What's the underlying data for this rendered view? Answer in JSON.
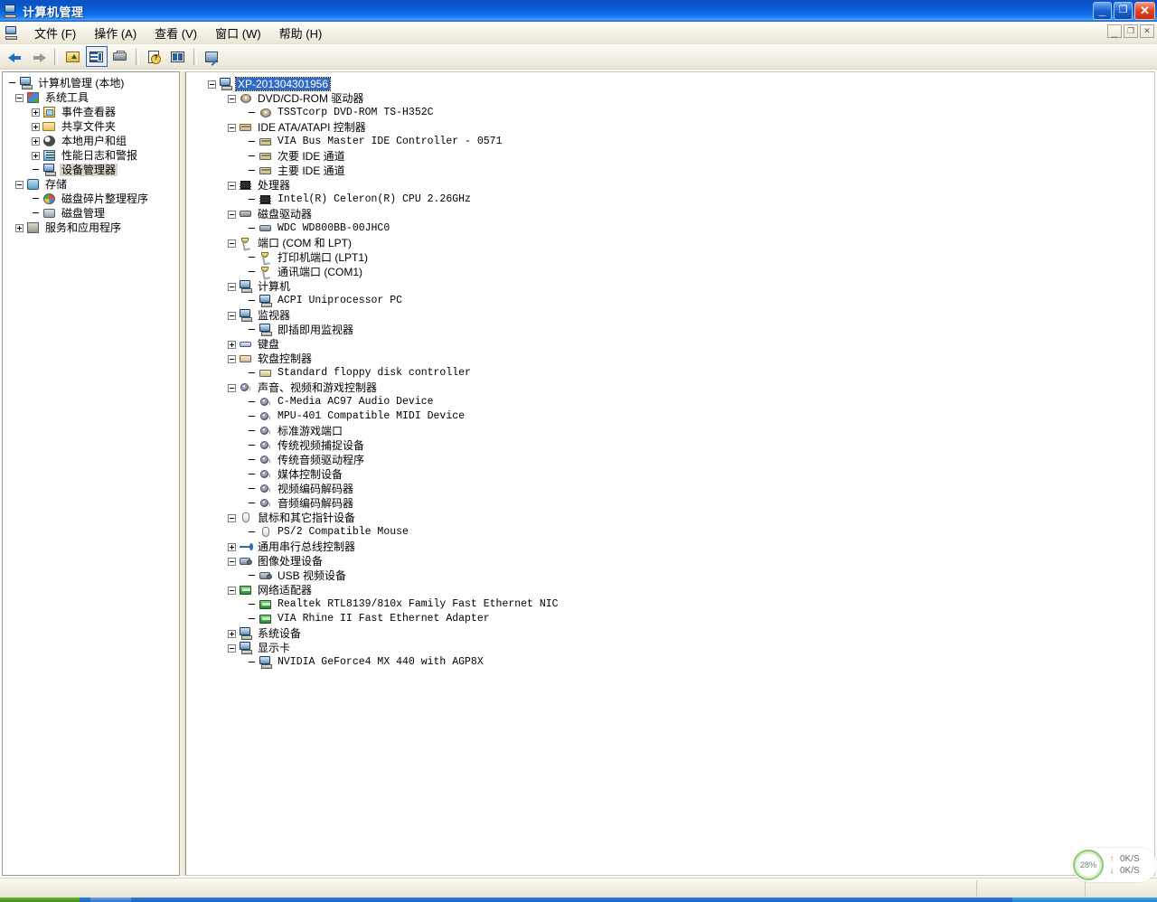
{
  "window": {
    "title": "计算机管理",
    "title_icon": "computer-management-icon",
    "buttons": {
      "minimize": "_",
      "maximize": "❐",
      "close": "✕"
    }
  },
  "menubar": {
    "icon": "console-icon",
    "items": [
      {
        "label": "文件 (F)",
        "name": "menu-file"
      },
      {
        "label": "操作 (A)",
        "name": "menu-action"
      },
      {
        "label": "查看 (V)",
        "name": "menu-view"
      },
      {
        "label": "窗口 (W)",
        "name": "menu-window"
      },
      {
        "label": "帮助 (H)",
        "name": "menu-help"
      }
    ]
  },
  "toolbar": {
    "buttons": [
      {
        "name": "back-icon",
        "tip": "后退"
      },
      {
        "name": "forward-icon",
        "tip": "前进"
      },
      {
        "name": "up-one-level-icon",
        "tip": "向上一级"
      },
      {
        "name": "show-hide-tree-icon",
        "tip": "显示/隐藏控制台树",
        "pressed": true
      },
      {
        "name": "print-icon",
        "tip": "打印"
      },
      {
        "name": "properties-icon",
        "tip": "属性"
      },
      {
        "name": "two-pane-view-icon",
        "tip": "查看"
      },
      {
        "name": "scan-hardware-changes-icon",
        "tip": "扫描检测硬件改动"
      }
    ]
  },
  "child_window_buttons": {
    "minimize": "_",
    "restore": "❐",
    "close": "✕"
  },
  "console_tree": {
    "root": {
      "label": "计算机管理 (本地)",
      "icon": "computer-icon",
      "level": 0,
      "expander": "none"
    },
    "items": [
      {
        "label": "系统工具",
        "icon": "system-tools-icon",
        "level": 1,
        "expander": "minus",
        "name": "tree-item-system-tools"
      },
      {
        "label": "事件查看器",
        "icon": "event-viewer-icon",
        "level": 2,
        "expander": "plus",
        "name": "tree-item-event-viewer"
      },
      {
        "label": "共享文件夹",
        "icon": "shared-folders-icon",
        "level": 2,
        "expander": "plus",
        "name": "tree-item-shared-folders"
      },
      {
        "label": "本地用户和组",
        "icon": "local-users-groups-icon",
        "level": 2,
        "expander": "plus",
        "name": "tree-item-local-users-and-groups"
      },
      {
        "label": "性能日志和警报",
        "icon": "performance-logs-icon",
        "level": 2,
        "expander": "plus",
        "name": "tree-item-performance-logs-and-alerts"
      },
      {
        "label": "设备管理器",
        "icon": "device-manager-icon",
        "level": 2,
        "expander": "none",
        "selected": true,
        "name": "tree-item-device-manager"
      },
      {
        "label": "存储",
        "icon": "storage-icon",
        "level": 1,
        "expander": "minus",
        "name": "tree-item-storage"
      },
      {
        "label": "磁盘碎片整理程序",
        "icon": "disk-defragmenter-icon",
        "level": 2,
        "expander": "none",
        "name": "tree-item-disk-defragmenter"
      },
      {
        "label": "磁盘管理",
        "icon": "disk-management-icon",
        "level": 2,
        "expander": "none",
        "name": "tree-item-disk-management"
      },
      {
        "label": "服务和应用程序",
        "icon": "services-applications-icon",
        "level": 1,
        "expander": "plus",
        "name": "tree-item-services-and-applications"
      }
    ]
  },
  "device_tree": {
    "root": {
      "label": "XP-201304301956",
      "icon": "computer-icon",
      "expander": "minus",
      "selected": true,
      "name": "device-tree-root"
    },
    "categories": [
      {
        "label": "DVD/CD-ROM 驱动器",
        "icon": "cdrom-icon",
        "expander": "minus",
        "name": "device-category-dvd-cdrom",
        "children": [
          {
            "label": "TSSTcorp DVD-ROM TS-H352C",
            "icon": "cdrom-icon",
            "mono": true
          }
        ]
      },
      {
        "label": "IDE ATA/ATAPI 控制器",
        "icon": "ide-controller-icon",
        "expander": "minus",
        "name": "device-category-ide-ata-atapi",
        "children": [
          {
            "label": "VIA Bus Master IDE Controller - 0571",
            "icon": "ide-controller-icon",
            "mono": true
          },
          {
            "label": "次要 IDE 通道",
            "icon": "ide-controller-icon"
          },
          {
            "label": "主要 IDE 通道",
            "icon": "ide-controller-icon"
          }
        ]
      },
      {
        "label": "处理器",
        "icon": "cpu-icon",
        "expander": "minus",
        "name": "device-category-processors",
        "children": [
          {
            "label": "Intel(R) Celeron(R) CPU 2.26GHz",
            "icon": "cpu-icon",
            "mono": true
          }
        ]
      },
      {
        "label": "磁盘驱动器",
        "icon": "disk-drive-icon",
        "expander": "minus",
        "name": "device-category-disk-drives",
        "children": [
          {
            "label": "WDC WD800BB-00JHC0",
            "icon": "disk-drive-icon",
            "mono": true
          }
        ]
      },
      {
        "label": "端口 (COM 和 LPT)",
        "icon": "port-icon",
        "expander": "minus",
        "name": "device-category-ports",
        "children": [
          {
            "label": "打印机端口 (LPT1)",
            "icon": "port-icon"
          },
          {
            "label": "通讯端口 (COM1)",
            "icon": "port-icon"
          }
        ]
      },
      {
        "label": "计算机",
        "icon": "computer-icon",
        "expander": "minus",
        "name": "device-category-computer",
        "children": [
          {
            "label": "ACPI Uniprocessor PC",
            "icon": "computer-icon",
            "mono": true
          }
        ]
      },
      {
        "label": "监视器",
        "icon": "monitor-icon",
        "expander": "minus",
        "name": "device-category-monitors",
        "children": [
          {
            "label": "即插即用监视器",
            "icon": "monitor-icon"
          }
        ]
      },
      {
        "label": "键盘",
        "icon": "keyboard-icon",
        "expander": "plus",
        "name": "device-category-keyboards",
        "children": []
      },
      {
        "label": "软盘控制器",
        "icon": "floppy-controller-icon",
        "expander": "minus",
        "name": "device-category-floppy-controllers",
        "children": [
          {
            "label": "Standard floppy disk controller",
            "icon": "floppy-controller-icon",
            "mono": true
          }
        ]
      },
      {
        "label": "声音、视频和游戏控制器",
        "icon": "sound-icon",
        "expander": "minus",
        "name": "device-category-sound-video-game-controllers",
        "children": [
          {
            "label": "C-Media AC97 Audio Device",
            "icon": "sound-icon",
            "mono": true
          },
          {
            "label": "MPU-401 Compatible MIDI Device",
            "icon": "sound-icon",
            "mono": true
          },
          {
            "label": "标准游戏端口",
            "icon": "sound-icon"
          },
          {
            "label": "传统视频捕捉设备",
            "icon": "sound-icon"
          },
          {
            "label": "传统音频驱动程序",
            "icon": "sound-icon"
          },
          {
            "label": "媒体控制设备",
            "icon": "sound-icon"
          },
          {
            "label": "视频编码解码器",
            "icon": "sound-icon"
          },
          {
            "label": "音频编码解码器",
            "icon": "sound-icon"
          }
        ]
      },
      {
        "label": "鼠标和其它指针设备",
        "icon": "mouse-icon",
        "expander": "minus",
        "name": "device-category-mice-and-pointing-devices",
        "children": [
          {
            "label": "PS/2 Compatible Mouse",
            "icon": "mouse-icon",
            "mono": true
          }
        ]
      },
      {
        "label": "通用串行总线控制器",
        "icon": "usb-icon",
        "expander": "plus",
        "name": "device-category-usb-controllers",
        "children": []
      },
      {
        "label": "图像处理设备",
        "icon": "imaging-icon",
        "expander": "minus",
        "name": "device-category-imaging-devices",
        "children": [
          {
            "label": "USB 视频设备",
            "icon": "imaging-icon"
          }
        ]
      },
      {
        "label": "网络适配器",
        "icon": "network-adapter-icon",
        "expander": "minus",
        "name": "device-category-network-adapters",
        "children": [
          {
            "label": "Realtek RTL8139/810x Family Fast Ethernet NIC",
            "icon": "network-adapter-icon",
            "mono": true
          },
          {
            "label": "VIA Rhine II Fast Ethernet Adapter",
            "icon": "network-adapter-icon",
            "mono": true
          }
        ]
      },
      {
        "label": "系统设备",
        "icon": "system-device-icon",
        "expander": "plus",
        "name": "device-category-system-devices",
        "children": []
      },
      {
        "label": "显示卡",
        "icon": "display-adapter-icon",
        "expander": "minus",
        "name": "device-category-display-adapters",
        "children": [
          {
            "label": "NVIDIA GeForce4 MX 440 with AGP8X",
            "icon": "display-adapter-icon",
            "mono": true
          }
        ]
      }
    ]
  },
  "speed_widget": {
    "gauge_value": "28%",
    "upload": "0K/S",
    "download": "0K/S",
    "up_arrow": "↑",
    "down_arrow": "↓"
  },
  "colors": {
    "titlebar_blue": "#0a5ed6",
    "selection_blue": "#316ac5",
    "inactive_selection": "#d8d4c8",
    "toolbar_beige": "#f1eee2",
    "gauge_green": "#8fc878"
  }
}
